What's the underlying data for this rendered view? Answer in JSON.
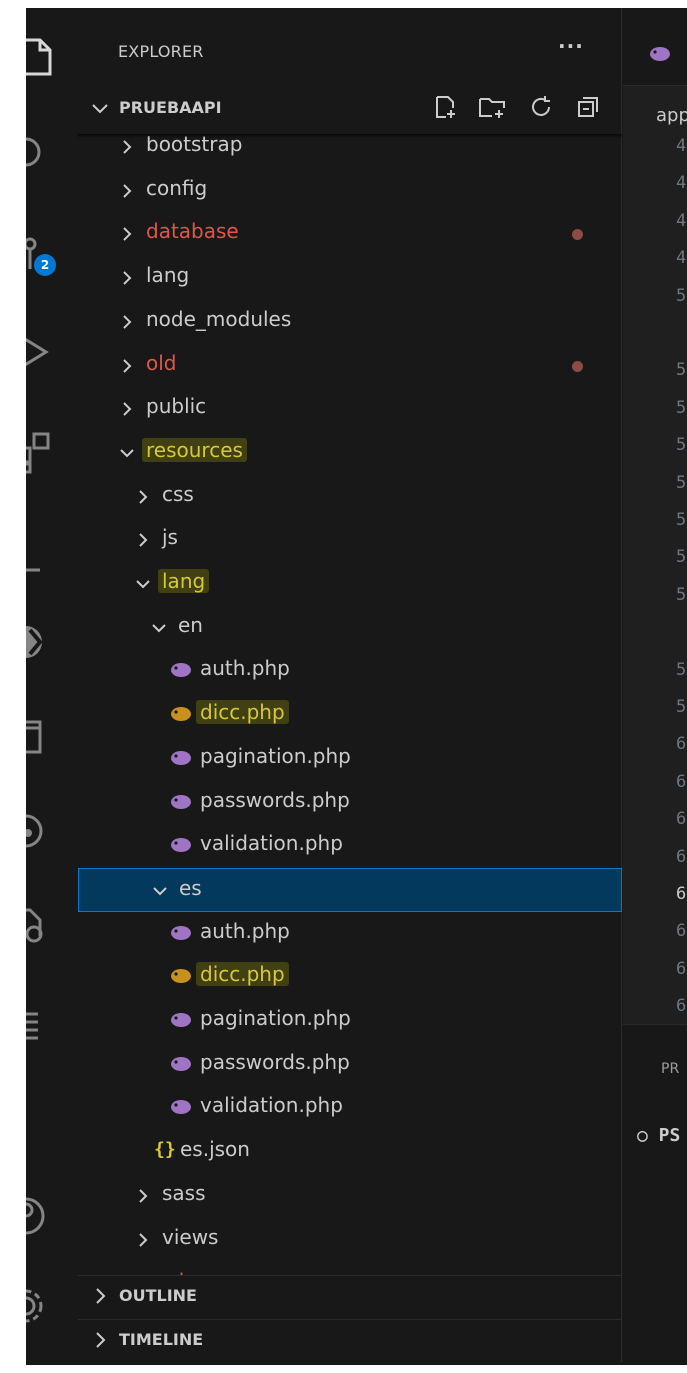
{
  "colors": {
    "background": "#181818",
    "selection": "#04395e",
    "selection_border": "#0078d4",
    "modified": "#e0574a",
    "highlight": "#d7c83a",
    "php_icon": "#a074c4"
  },
  "activity_bar": {
    "items": [
      {
        "icon": "files-icon"
      },
      {
        "icon": "search-icon"
      },
      {
        "icon": "source-control-icon",
        "badge": "2"
      },
      {
        "icon": "run-debug-icon"
      },
      {
        "icon": "extensions-icon"
      },
      {
        "icon": "testing-icon"
      },
      {
        "icon": "remote-explorer-icon"
      },
      {
        "icon": "folder-icon"
      },
      {
        "icon": "gitlens-icon"
      },
      {
        "icon": "docker-icon"
      },
      {
        "icon": "list-icon"
      },
      {
        "icon": "accounts-icon"
      },
      {
        "icon": "settings-gear-icon"
      }
    ]
  },
  "sidebar": {
    "title": "EXPLORER",
    "more": "···",
    "project": "PRUEBAAPI",
    "project_actions": [
      "new-file-icon",
      "new-folder-icon",
      "refresh-icon",
      "collapse-all-icon"
    ],
    "tree": [
      {
        "label": "bootstrap",
        "type": "folder",
        "expanded": false
      },
      {
        "label": "config",
        "type": "folder",
        "expanded": false
      },
      {
        "label": "database",
        "type": "folder",
        "expanded": false,
        "modified": true
      },
      {
        "label": "lang",
        "type": "folder",
        "expanded": false
      },
      {
        "label": "node_modules",
        "type": "folder",
        "expanded": false
      },
      {
        "label": "old",
        "type": "folder",
        "expanded": false,
        "modified": true
      },
      {
        "label": "public",
        "type": "folder",
        "expanded": false
      },
      {
        "label": "resources",
        "type": "folder",
        "expanded": true,
        "highlighted": true
      },
      {
        "label": "css",
        "type": "folder",
        "expanded": false
      },
      {
        "label": "js",
        "type": "folder",
        "expanded": false
      },
      {
        "label": "lang",
        "type": "folder",
        "expanded": true,
        "highlighted": true
      },
      {
        "label": "en",
        "type": "folder",
        "expanded": true
      },
      {
        "label": "auth.php",
        "type": "php"
      },
      {
        "label": "dicc.php",
        "type": "php",
        "highlighted": true
      },
      {
        "label": "pagination.php",
        "type": "php"
      },
      {
        "label": "passwords.php",
        "type": "php"
      },
      {
        "label": "validation.php",
        "type": "php"
      },
      {
        "label": "es",
        "type": "folder",
        "expanded": true,
        "selected": true
      },
      {
        "label": "auth.php",
        "type": "php"
      },
      {
        "label": "dicc.php",
        "type": "php",
        "highlighted": true
      },
      {
        "label": "pagination.php",
        "type": "php"
      },
      {
        "label": "passwords.php",
        "type": "php"
      },
      {
        "label": "validation.php",
        "type": "php"
      },
      {
        "label": "es.json",
        "type": "json"
      },
      {
        "label": "sass",
        "type": "folder",
        "expanded": false
      },
      {
        "label": "views",
        "type": "folder",
        "expanded": false
      },
      {
        "label": "routes",
        "type": "folder",
        "expanded": false,
        "modified": true
      }
    ],
    "outline": "OUTLINE",
    "timeline": "TIMELINE"
  },
  "editor": {
    "tab_icon": "php-elephant-icon",
    "breadcrumb": "app",
    "line_numbers": [
      "4",
      "4",
      "4",
      "4",
      "5",
      "",
      "5",
      "5",
      "5",
      "5",
      "5",
      "5",
      "5",
      "",
      "5",
      "5",
      "6",
      "6",
      "6",
      "6",
      "6",
      "6",
      "6",
      "6"
    ],
    "current_line_index": 20
  },
  "panel": {
    "tab": "PR",
    "terminal": "○ PS"
  }
}
